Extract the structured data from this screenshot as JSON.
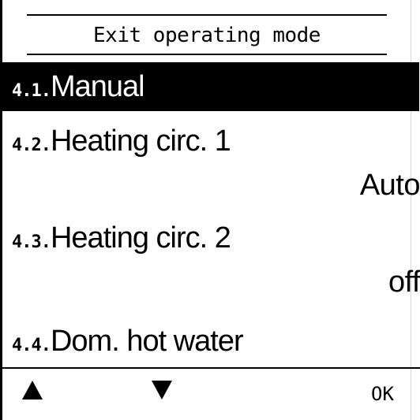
{
  "header": {
    "title": "Exit operating mode"
  },
  "menu": {
    "items": [
      {
        "number": "4.1.",
        "label": "Manual",
        "value": "",
        "selected": true
      },
      {
        "number": "4.2.",
        "label": "Heating circ. 1",
        "value": "Auto",
        "selected": false
      },
      {
        "number": "4.3.",
        "label": "Heating circ. 2",
        "value": "off",
        "selected": false
      },
      {
        "number": "4.4.",
        "label": "Dom. hot water",
        "value": "",
        "selected": false
      }
    ]
  },
  "softkeys": {
    "up_icon": "up-arrow-icon",
    "down_icon": "down-arrow-icon",
    "ok_label": "OK"
  },
  "colors": {
    "background": "#ffffff",
    "foreground": "#000000",
    "selection_bg": "#000000",
    "selection_fg": "#ffffff"
  }
}
